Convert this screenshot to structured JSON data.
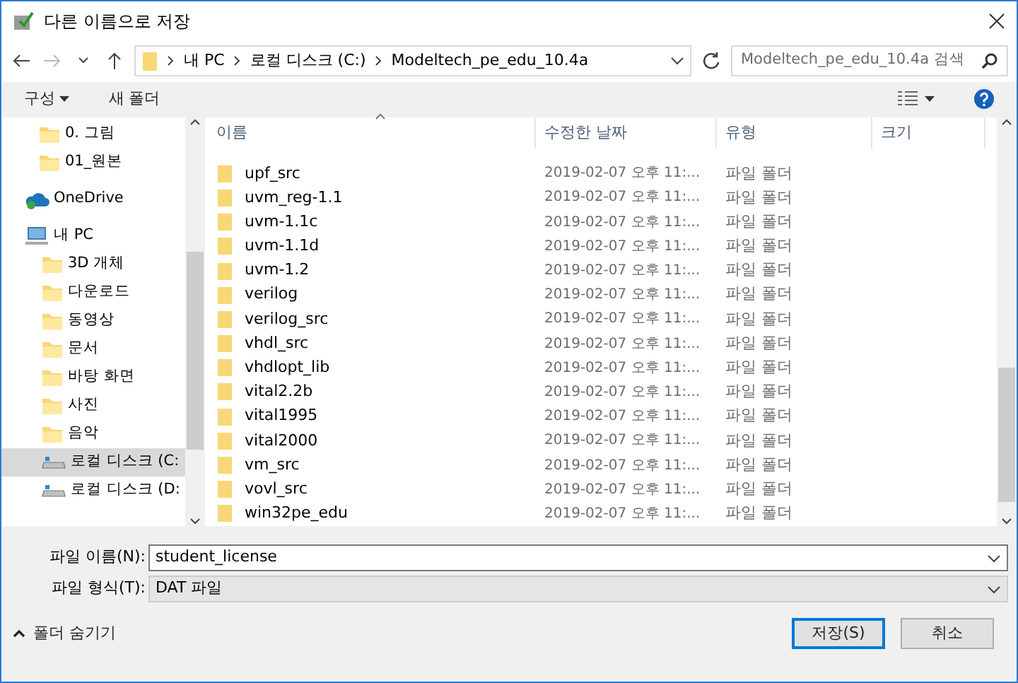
{
  "window": {
    "title": "다른 이름으로 저장"
  },
  "address": {
    "crumbs": [
      "내 PC",
      "로컬 디스크 (C:)",
      "Modeltech_pe_edu_10.4a"
    ],
    "search_placeholder": "Modeltech_pe_edu_10.4a 검색"
  },
  "toolbar": {
    "organize": "구성",
    "new_folder": "새 폴더"
  },
  "sidebar": {
    "items": [
      {
        "label": "0. 그림",
        "kind": "folder",
        "selected": false
      },
      {
        "label": "01_원본",
        "kind": "folder",
        "selected": false
      },
      {
        "label": "OneDrive",
        "kind": "cloud",
        "selected": false
      },
      {
        "label": "내 PC",
        "kind": "pc",
        "selected": false,
        "children": [
          {
            "label": "3D 개체",
            "kind": "folder",
            "selected": false
          },
          {
            "label": "다운로드",
            "kind": "folder",
            "selected": false
          },
          {
            "label": "동영상",
            "kind": "folder",
            "selected": false
          },
          {
            "label": "문서",
            "kind": "folder",
            "selected": false
          },
          {
            "label": "바탕 화면",
            "kind": "folder",
            "selected": false
          },
          {
            "label": "사진",
            "kind": "folder",
            "selected": false
          },
          {
            "label": "음악",
            "kind": "folder",
            "selected": false
          },
          {
            "label": "로컬 디스크 (C:",
            "kind": "drive",
            "selected": true
          },
          {
            "label": "로컬 디스크 (D:",
            "kind": "drive",
            "selected": false
          }
        ]
      }
    ]
  },
  "table": {
    "columns": [
      "이름",
      "수정한 날짜",
      "유형",
      "크기"
    ],
    "rows": [
      {
        "name": "upf_src",
        "date": "2019-02-07 오후 11:...",
        "type": "파일 폴더"
      },
      {
        "name": "uvm_reg-1.1",
        "date": "2019-02-07 오후 11:...",
        "type": "파일 폴더"
      },
      {
        "name": "uvm-1.1c",
        "date": "2019-02-07 오후 11:...",
        "type": "파일 폴더"
      },
      {
        "name": "uvm-1.1d",
        "date": "2019-02-07 오후 11:...",
        "type": "파일 폴더"
      },
      {
        "name": "uvm-1.2",
        "date": "2019-02-07 오후 11:...",
        "type": "파일 폴더"
      },
      {
        "name": "verilog",
        "date": "2019-02-07 오후 11:...",
        "type": "파일 폴더"
      },
      {
        "name": "verilog_src",
        "date": "2019-02-07 오후 11:...",
        "type": "파일 폴더"
      },
      {
        "name": "vhdl_src",
        "date": "2019-02-07 오후 11:...",
        "type": "파일 폴더"
      },
      {
        "name": "vhdlopt_lib",
        "date": "2019-02-07 오후 11:...",
        "type": "파일 폴더"
      },
      {
        "name": "vital2.2b",
        "date": "2019-02-07 오후 11:...",
        "type": "파일 폴더"
      },
      {
        "name": "vital1995",
        "date": "2019-02-07 오후 11:...",
        "type": "파일 폴더"
      },
      {
        "name": "vital2000",
        "date": "2019-02-07 오후 11:...",
        "type": "파일 폴더"
      },
      {
        "name": "vm_src",
        "date": "2019-02-07 오후 11:...",
        "type": "파일 폴더"
      },
      {
        "name": "vovl_src",
        "date": "2019-02-07 오후 11:...",
        "type": "파일 폴더"
      },
      {
        "name": "win32pe_edu",
        "date": "2019-02-07 오후 11:...",
        "type": "파일 폴더"
      }
    ]
  },
  "file_name": {
    "label": "파일 이름(N):",
    "value": "student_license"
  },
  "file_type": {
    "label": "파일 형식(T):",
    "value": "DAT 파일"
  },
  "footer": {
    "hide_folders": "폴더 숨기기",
    "buttons": [
      {
        "label": "저장(S)",
        "kind": "default"
      },
      {
        "label": "취소",
        "kind": "normal"
      }
    ]
  }
}
